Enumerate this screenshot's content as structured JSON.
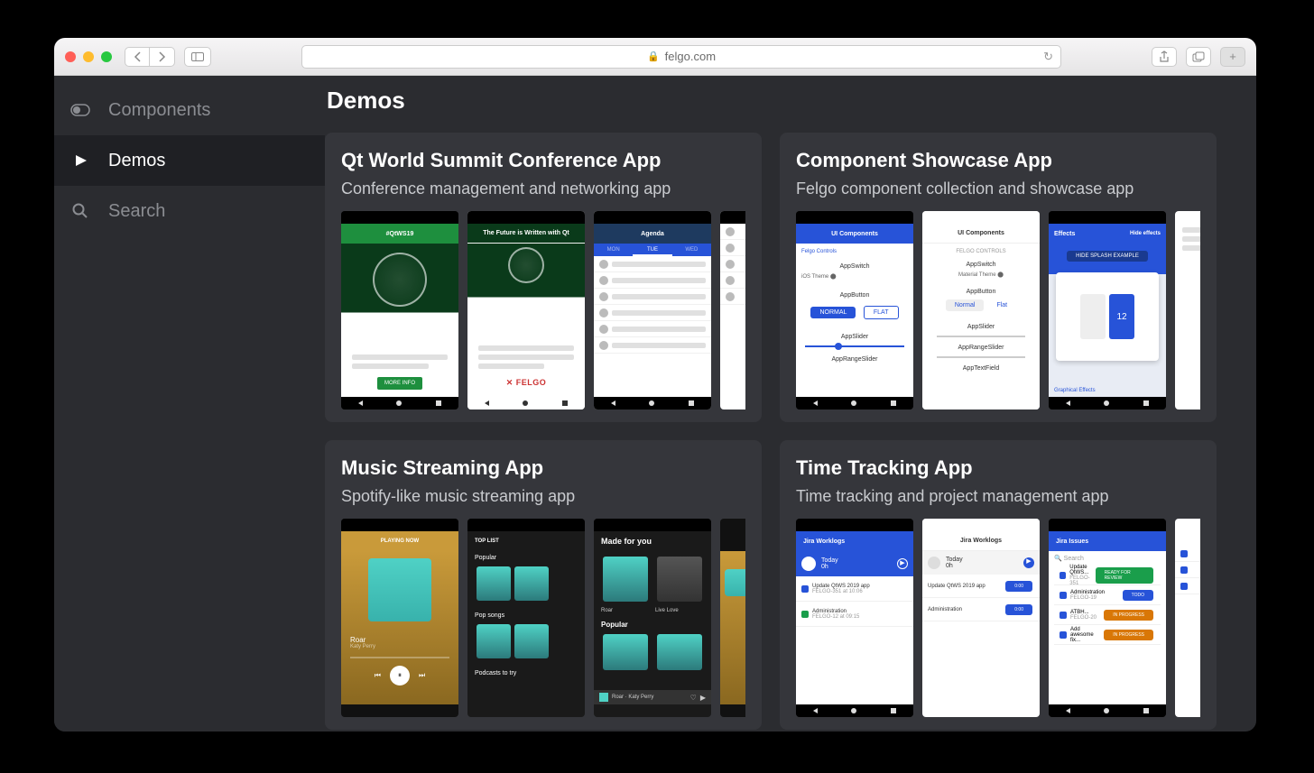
{
  "browser": {
    "url": "felgo.com",
    "share_aria": "Share",
    "tabs_aria": "Tabs",
    "newtab_aria": "New Tab"
  },
  "sidebar": {
    "items": [
      {
        "name": "components",
        "label": "Components",
        "icon": "toggle"
      },
      {
        "name": "demos",
        "label": "Demos",
        "icon": "play",
        "active": true
      },
      {
        "name": "search",
        "label": "Search",
        "icon": "search"
      }
    ]
  },
  "page": {
    "title": "Demos"
  },
  "demos": [
    {
      "id": "qt-world-summit",
      "title": "Qt World Summit Conference App",
      "subtitle": "Conference management and networking app"
    },
    {
      "id": "component-showcase",
      "title": "Component Showcase App",
      "subtitle": "Felgo component collection and showcase app"
    },
    {
      "id": "music-streaming",
      "title": "Music Streaming App",
      "subtitle": "Spotify-like music streaming app"
    },
    {
      "id": "time-tracking",
      "title": "Time Tracking App",
      "subtitle": "Time tracking and project management app"
    }
  ],
  "thumbs": {
    "qt": [
      "#QtWS19",
      "The Future is Written with Qt",
      "Agenda",
      ""
    ],
    "showcase": [
      "UI Components",
      "UI Components",
      "Effects",
      ""
    ],
    "music": [
      "PLAYING NOW",
      "TOP LIST",
      "Made for you",
      ""
    ],
    "time": [
      "Jira Worklogs",
      "Jira Worklogs",
      "Jira Issues",
      ""
    ]
  },
  "misc": {
    "felgo": "✕ FELGO",
    "roar": "Roar",
    "artist": "Katy Perry",
    "normal": "NORMAL",
    "flat": "FLAT",
    "search_ph": "Search"
  }
}
